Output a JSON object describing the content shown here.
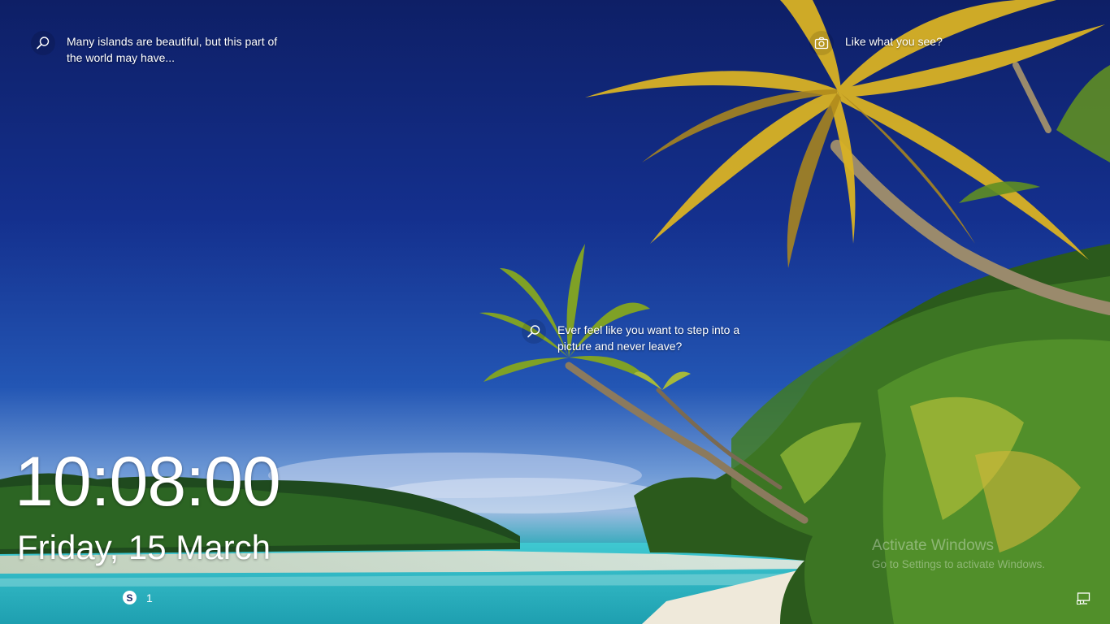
{
  "spotlight": {
    "hotspots": [
      {
        "text": "Many islands are beautiful, but this part of the world may have...",
        "icon": "search-icon"
      },
      {
        "text": "Like what you see?",
        "icon": "camera-icon"
      },
      {
        "text": "Ever feel like you want to step into a picture and never leave?",
        "icon": "search-icon"
      }
    ]
  },
  "lock_screen": {
    "time": "10:08:00",
    "date": "Friday, 15 March"
  },
  "notifications": {
    "app_icon": "skype-icon",
    "count": "1"
  },
  "watermark": {
    "title": "Activate Windows",
    "subtitle": "Go to Settings to activate Windows."
  },
  "status_icons": {
    "network_icon": "network-icon"
  },
  "colors": {
    "sky_top": "#0e1f66",
    "water": "#1fc2c8",
    "palm_leaf": "#d9b224"
  }
}
